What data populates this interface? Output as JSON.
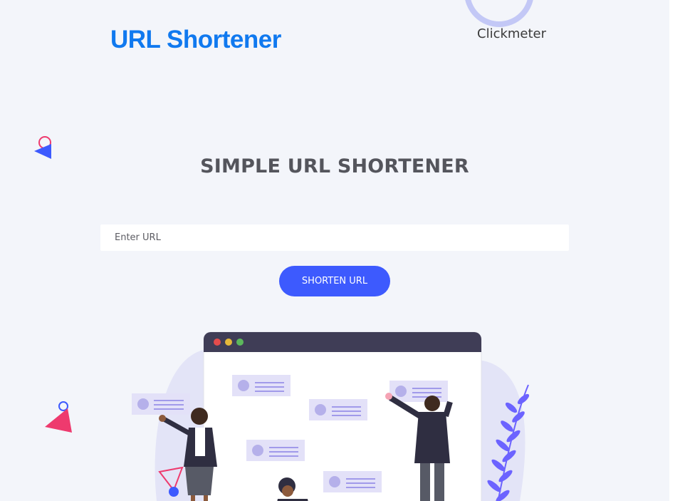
{
  "header": {
    "logo_text": "URL Shortener",
    "brand_link": "Clickmeter"
  },
  "hero": {
    "title": "SIMPLE URL SHORTENER",
    "input_placeholder": "Enter URL",
    "button_label": "SHORTEN URL"
  },
  "colors": {
    "logo": "#1079ef",
    "button": "#3d5afe",
    "page_background": "#f3f5fa",
    "accent_pink": "#ee3a6e",
    "accent_blue": "#3d5afe"
  },
  "icons": [
    "triangle-circle-decoration",
    "browser-window-illustration",
    "leaf-decoration"
  ]
}
